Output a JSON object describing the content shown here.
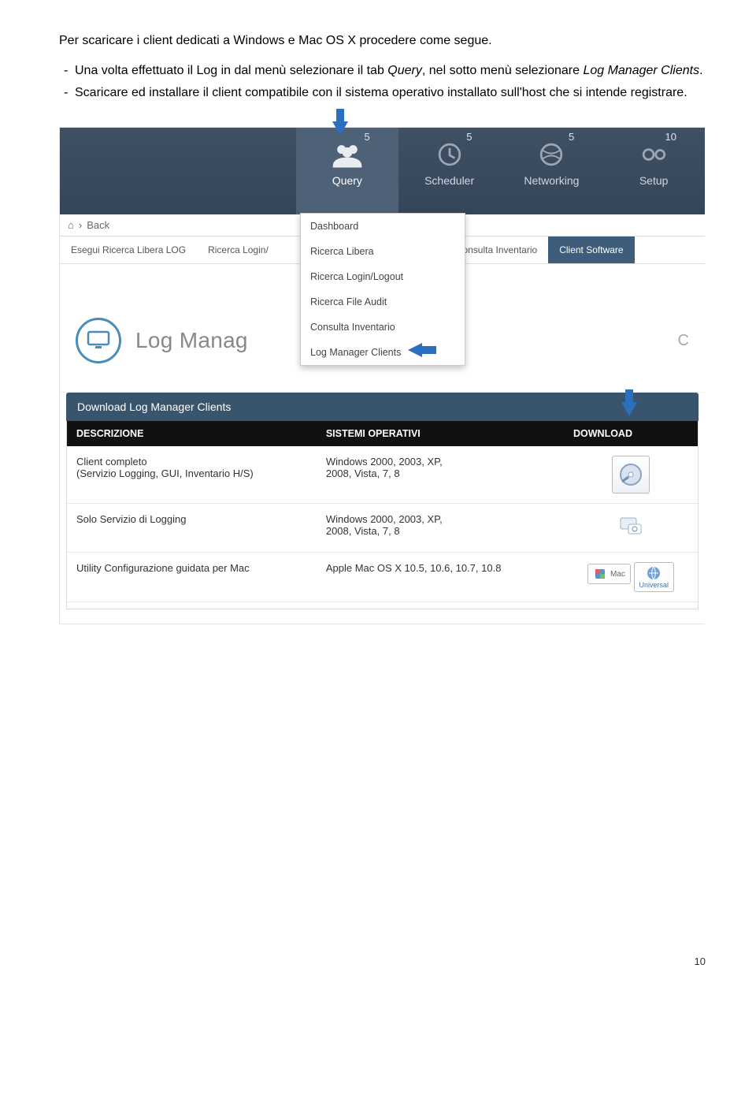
{
  "intro": "Per scaricare i client dedicati a Windows e Mac OS X procedere come segue.",
  "bullets": [
    {
      "pre": "Una volta effettuato il Log in dal menù selezionare il tab ",
      "em1": "Query",
      "mid": ", nel sotto menù selezionare ",
      "em2": "Log Manager Clients",
      "post": "."
    },
    {
      "text": "Scaricare ed installare il client compatibile con il sistema operativo installato sull'host che si intende registrare."
    }
  ],
  "nav": {
    "items": [
      {
        "label": "Query",
        "badge": "5"
      },
      {
        "label": "Scheduler",
        "badge": "5"
      },
      {
        "label": "Networking",
        "badge": "5"
      },
      {
        "label": "Setup",
        "badge": "10"
      }
    ]
  },
  "breadcrumb": {
    "back": "Back"
  },
  "subtabs": [
    "Esegui Ricerca Libera LOG",
    "Ricerca Login/",
    "",
    "Consulta Inventario",
    "Client Software"
  ],
  "dropdown": [
    "Dashboard",
    "Ricerca Libera",
    "Ricerca Login/Logout",
    "Ricerca File Audit",
    "Consulta Inventario",
    "Log Manager Clients"
  ],
  "page_title": "Log Manag",
  "page_title_right": "C",
  "panel_header": "Download Log Manager Clients",
  "table": {
    "headers": [
      "DESCRIZIONE",
      "SISTEMI OPERATIVI",
      "DOWNLOAD"
    ],
    "rows": [
      {
        "desc_l1": "Client completo",
        "desc_l2": "(Servizio Logging, GUI, Inventario H/S)",
        "os_l1": "Windows 2000, 2003, XP,",
        "os_l2": "2008, Vista, 7, 8"
      },
      {
        "desc_l1": "Solo Servizio di Logging",
        "desc_l2": "",
        "os_l1": "Windows 2000, 2003, XP,",
        "os_l2": "2008, Vista, 7, 8"
      },
      {
        "desc_l1": "Utility Configurazione guidata per Mac",
        "desc_l2": "",
        "os_l1": "Apple Mac OS X 10.5, 10.6, 10.7, 10.8",
        "os_l2": ""
      }
    ]
  },
  "mac_label": "Mac",
  "universal_label": "Universal",
  "page_number": "10"
}
